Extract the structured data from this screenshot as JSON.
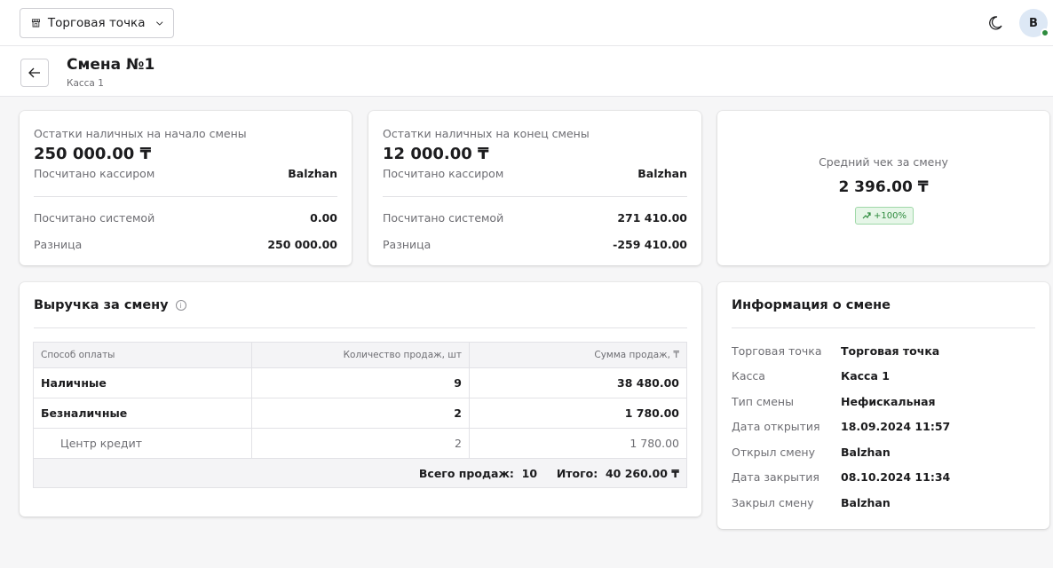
{
  "topbar": {
    "store_label": "Торговая точка",
    "avatar_initial": "B"
  },
  "header": {
    "title": "Смена №1",
    "subtitle": "Касса 1"
  },
  "cash_start": {
    "label": "Остатки наличных на начало смены",
    "amount": "250 000.00 ₸",
    "counted_by_cashier_label": "Посчитано кассиром",
    "counted_by_cashier_value": "Balzhan",
    "counted_by_system_label": "Посчитано системой",
    "counted_by_system_value": "0.00",
    "difference_label": "Разница",
    "difference_value": "250 000.00"
  },
  "cash_end": {
    "label": "Остатки наличных на конец смены",
    "amount": "12 000.00 ₸",
    "counted_by_cashier_label": "Посчитано кассиром",
    "counted_by_cashier_value": "Balzhan",
    "counted_by_system_label": "Посчитано системой",
    "counted_by_system_value": "271 410.00",
    "difference_label": "Разница",
    "difference_value": "-259 410.00"
  },
  "avg_check": {
    "label": "Средний чек за смену",
    "value": "2 396.00 ₸",
    "trend": "+100%",
    "trend_color": "#2e8b3e"
  },
  "revenue": {
    "title": "Выручка за смену",
    "columns": [
      "Способ оплаты",
      "Количество продаж, шт",
      "Сумма продаж, ₸"
    ],
    "rows": [
      {
        "method": "Наличные",
        "count": "9",
        "sum": "38 480.00"
      },
      {
        "method": "Безналичные",
        "count": "2",
        "sum": "1 780.00"
      },
      {
        "method": "Центр кредит",
        "count": "2",
        "sum": "1 780.00"
      }
    ],
    "total_sales_label": "Всего продаж:",
    "total_sales_value": "10",
    "total_label": "Итого:",
    "total_value": "40 260.00 ₸"
  },
  "shift_info": {
    "title": "Информация о смене",
    "items": [
      {
        "label": "Торговая точка",
        "value": "Торговая точка"
      },
      {
        "label": "Касса",
        "value": "Касса 1"
      },
      {
        "label": "Тип смены",
        "value": "Нефискальная"
      },
      {
        "label": "Дата открытия",
        "value": "18.09.2024 11:57"
      },
      {
        "label": "Открыл смену",
        "value": "Balzhan"
      },
      {
        "label": "Дата закрытия",
        "value": "08.10.2024 11:34"
      },
      {
        "label": "Закрыл смену",
        "value": "Balzhan"
      }
    ]
  },
  "colors": {
    "accent_green": "#2e8b3e",
    "avatar_bg": "#dde8f5"
  }
}
